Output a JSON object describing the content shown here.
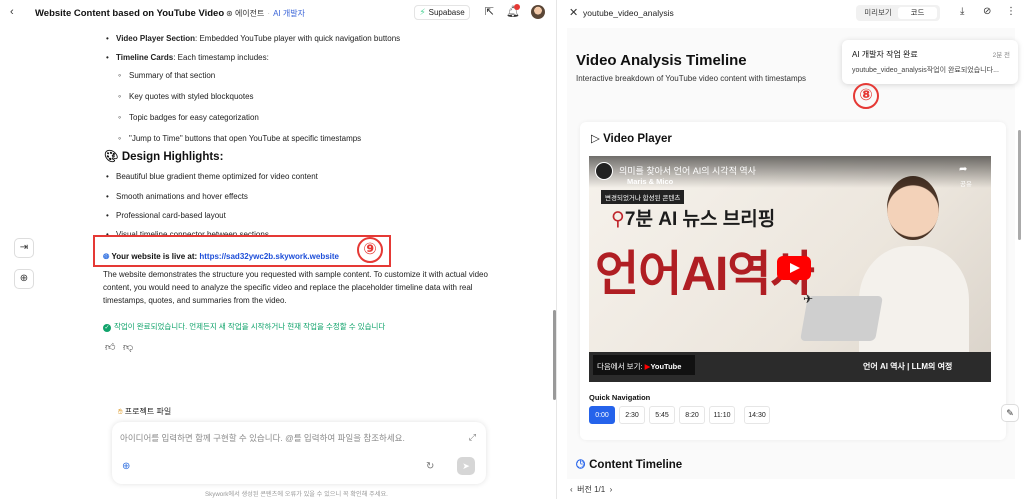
{
  "left": {
    "header": {
      "title": "Website Content based on YouTube Video",
      "agent": "에이전트",
      "agent_role": "AI 개발자",
      "supabase": "Supabase"
    },
    "bullets_top": [
      {
        "bold": "Video Player Section",
        "text": ": Embedded YouTube player with quick navigation buttons"
      },
      {
        "bold": "Timeline Cards",
        "text": ": Each timestamp includes:"
      }
    ],
    "sub_bullets": [
      "Summary of that section",
      "Key quotes with styled blockquotes",
      "Topic badges for easy categorization",
      "\"Jump to Time\" buttons that open YouTube at specific timestamps"
    ],
    "design_heading": "Design Highlights:",
    "design_bullets": [
      "Beautiful blue gradient theme optimized for video content",
      "Smooth animations and hover effects",
      "Professional card-based layout",
      "Visual timeline connector between sections"
    ],
    "live_label": "Your website is live at:",
    "live_url": "https://sad32ywc2b.skywork.website",
    "annotation_left": "⑨",
    "paragraph": "The website demonstrates the structure you requested with sample content. To customize it with actual video content, you would need to analyze the specific video and replace the placeholder timeline data with real timestamps, quotes, and summaries from the video.",
    "done_msg": "작업이 완료되었습니다. 언제든지 새 작업을 시작하거나 현재 작업을 수정할 수 있습니다",
    "project_file": "프로젝트 파일",
    "composer_placeholder": "아이디어를 입력하면 함께 구현할 수 있습니다. @를 입력하여 파일을 참조하세요.",
    "disclaimer": "Skywork에서 생성된 콘텐츠에 오류가 있을 수 있으니 꼭 확인해 주세요."
  },
  "right": {
    "file_title": "youtube_video_analysis",
    "tab_preview": "미리보기",
    "tab_code": "코드",
    "page_title": "Video Analysis Timeline",
    "page_subtitle": "Interactive breakdown of YouTube video content with timestamps",
    "toast_title": "AI 개발자 작업 완료",
    "toast_time": "2분 전",
    "toast_body": "youtube_video_analysis작업이 완료되었습니다...",
    "annotation_right": "⑧",
    "video_player_heading": "Video Player",
    "video": {
      "title": "의미를 찾아서 언어 AI의 시각적 역사",
      "channel": "Maris & Mico",
      "tag": "변경되었거나 합성된 콘텐츠",
      "headline": "7분 AI 뉴스 브리핑",
      "big_text": "언어AI역사",
      "share": "공유",
      "watch_on": "다음에서 보기:",
      "youtube": "YouTube",
      "bottom_right": "언어 AI 역사 | LLM의 여정"
    },
    "quick_nav_label": "Quick Navigation",
    "quick_nav": [
      "0:00",
      "2:30",
      "5:45",
      "8:20",
      "11:10",
      "14:30"
    ],
    "content_timeline": "Content Timeline",
    "version": "버전 1/1"
  },
  "colors": {
    "accent_blue": "#2563eb",
    "annotation_red": "#e53935",
    "success_green": "#10a36b"
  }
}
